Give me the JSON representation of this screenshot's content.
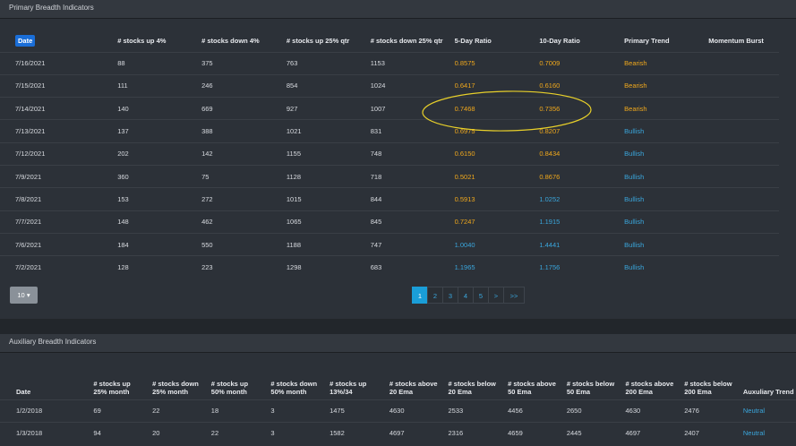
{
  "primary": {
    "title": "Primary Breadth Indicators",
    "columns": [
      "Date",
      "# stocks up 4%",
      "# stocks down 4%",
      "# stocks up 25% qtr",
      "# stocks down 25% qtr",
      "5-Day Ratio",
      "10-Day Ratio",
      "Primary Trend",
      "Momentum Burst"
    ],
    "rows": [
      {
        "date": "7/16/2021",
        "up4": "88",
        "down4": "375",
        "up25": "763",
        "down25": "1153",
        "r5": "0.8575",
        "r5c": "orange",
        "r10": "0.7009",
        "r10c": "orange",
        "trend": "Bearish",
        "trendc": "orange",
        "burst": ""
      },
      {
        "date": "7/15/2021",
        "up4": "111",
        "down4": "246",
        "up25": "854",
        "down25": "1024",
        "r5": "0.6417",
        "r5c": "orange",
        "r10": "0.6160",
        "r10c": "orange",
        "trend": "Bearish",
        "trendc": "orange",
        "burst": ""
      },
      {
        "date": "7/14/2021",
        "up4": "140",
        "down4": "669",
        "up25": "927",
        "down25": "1007",
        "r5": "0.7468",
        "r5c": "orange",
        "r10": "0.7356",
        "r10c": "orange",
        "trend": "Bearish",
        "trendc": "orange",
        "burst": ""
      },
      {
        "date": "7/13/2021",
        "up4": "137",
        "down4": "388",
        "up25": "1021",
        "down25": "831",
        "r5": "0.6975",
        "r5c": "orange",
        "r10": "0.8207",
        "r10c": "orange",
        "trend": "Bullish",
        "trendc": "blue",
        "burst": ""
      },
      {
        "date": "7/12/2021",
        "up4": "202",
        "down4": "142",
        "up25": "1155",
        "down25": "748",
        "r5": "0.6150",
        "r5c": "orange",
        "r10": "0.8434",
        "r10c": "orange",
        "trend": "Bullish",
        "trendc": "blue",
        "burst": ""
      },
      {
        "date": "7/9/2021",
        "up4": "360",
        "down4": "75",
        "up25": "1128",
        "down25": "718",
        "r5": "0.5021",
        "r5c": "orange",
        "r10": "0.8676",
        "r10c": "orange",
        "trend": "Bullish",
        "trendc": "blue",
        "burst": ""
      },
      {
        "date": "7/8/2021",
        "up4": "153",
        "down4": "272",
        "up25": "1015",
        "down25": "844",
        "r5": "0.5913",
        "r5c": "orange",
        "r10": "1.0252",
        "r10c": "blue",
        "trend": "Bullish",
        "trendc": "blue",
        "burst": ""
      },
      {
        "date": "7/7/2021",
        "up4": "148",
        "down4": "462",
        "up25": "1065",
        "down25": "845",
        "r5": "0.7247",
        "r5c": "orange",
        "r10": "1.1915",
        "r10c": "blue",
        "trend": "Bullish",
        "trendc": "blue",
        "burst": ""
      },
      {
        "date": "7/6/2021",
        "up4": "184",
        "down4": "550",
        "up25": "1188",
        "down25": "747",
        "r5": "1.0040",
        "r5c": "blue",
        "r10": "1.4441",
        "r10c": "blue",
        "trend": "Bullish",
        "trendc": "blue",
        "burst": ""
      },
      {
        "date": "7/2/2021",
        "up4": "128",
        "down4": "223",
        "up25": "1298",
        "down25": "683",
        "r5": "1.1965",
        "r5c": "blue",
        "r10": "1.1756",
        "r10c": "blue",
        "trend": "Bullish",
        "trendc": "blue",
        "burst": ""
      }
    ],
    "page_size": "10",
    "pages": [
      "1",
      "2",
      "3",
      "4",
      "5",
      ">",
      ">>"
    ],
    "active_page": "1"
  },
  "auxiliary": {
    "title": "Auxiliary Breadth Indicators",
    "columns": [
      [
        "Date"
      ],
      [
        "# stocks up",
        "25% month"
      ],
      [
        "# stocks down",
        "25% month"
      ],
      [
        "# stocks up",
        "50% month"
      ],
      [
        "# stocks down",
        "50% month"
      ],
      [
        "# stocks up",
        "13%/34"
      ],
      [
        "# stocks above",
        "20 Ema"
      ],
      [
        "# stocks below",
        "20 Ema"
      ],
      [
        "# stocks above",
        "50 Ema"
      ],
      [
        "# stocks below",
        "50 Ema"
      ],
      [
        "# stocks above",
        "200 Ema"
      ],
      [
        "# stocks below",
        "200 Ema"
      ],
      [
        "Auxuliary Trend"
      ]
    ],
    "rows": [
      [
        "1/2/2018",
        "69",
        "22",
        "18",
        "3",
        "1475",
        "4630",
        "2533",
        "4456",
        "2650",
        "4630",
        "2476",
        "Neutral"
      ],
      [
        "1/3/2018",
        "94",
        "20",
        "22",
        "3",
        "1582",
        "4697",
        "2316",
        "4659",
        "2445",
        "4697",
        "2407",
        "Neutral"
      ]
    ]
  },
  "colors": {
    "orange": "#f0a81c",
    "blue": "#3aa6dc",
    "annotation": "#e8d02a"
  }
}
